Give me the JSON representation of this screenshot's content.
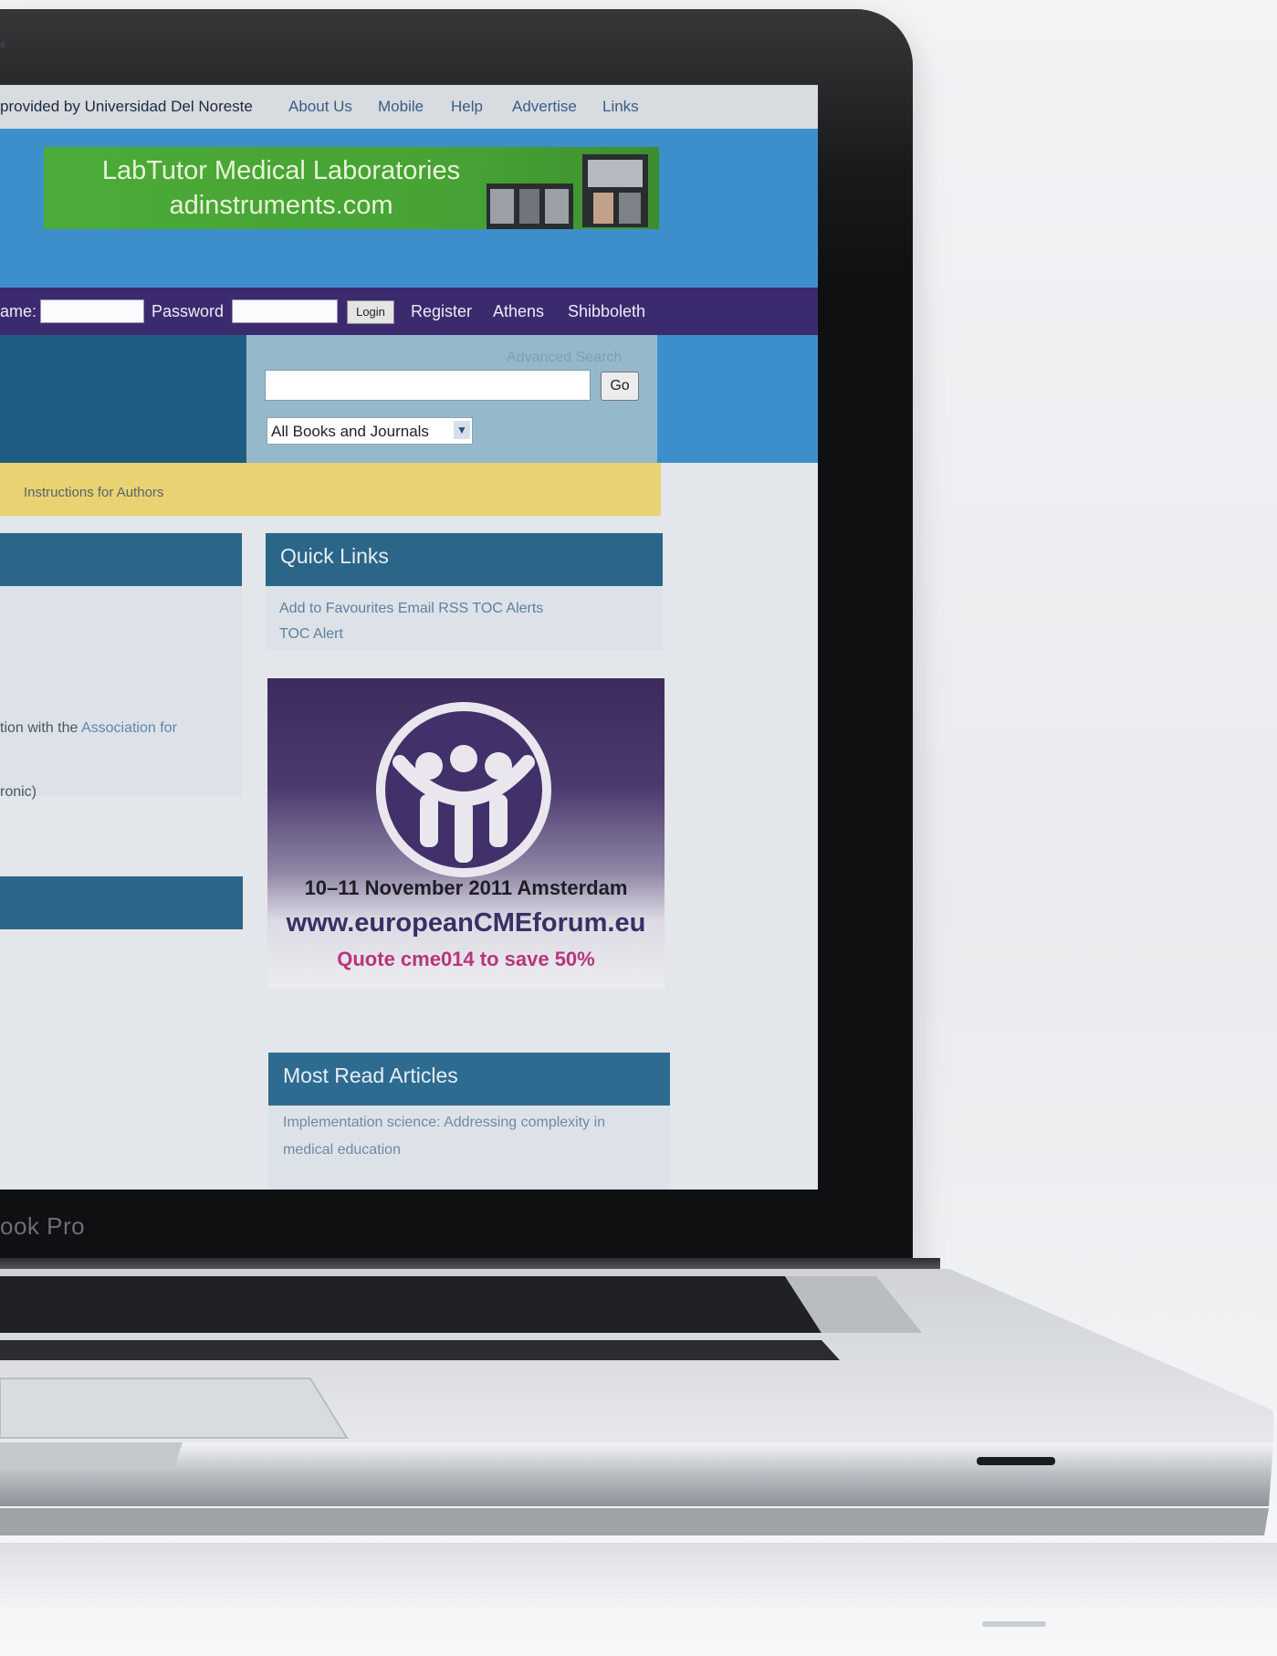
{
  "topbar": {
    "access_notice": "provided by Universidad Del Noreste",
    "links": [
      "About Us",
      "Mobile",
      "Help",
      "Advertise",
      "Links"
    ]
  },
  "banner_ad": {
    "line1": "LabTutor Medical Laboratories",
    "line2": "adinstruments.com"
  },
  "login": {
    "username_label": "ame:",
    "password_label": "Password",
    "login_button": "Login",
    "links": [
      "Register",
      "Athens",
      "Shibboleth"
    ]
  },
  "search": {
    "advanced_link": "Advanced Search",
    "go_button": "Go",
    "scope_selected": "All Books and Journals"
  },
  "nav": {
    "instructions_link": "Instructions for Authors"
  },
  "main": {
    "snippet1_text": "tion with the ",
    "snippet1_link": "Association for",
    "snippet2_text": "ronic)"
  },
  "quick_links": {
    "title": "Quick Links",
    "line1": "Add to Favourites Email   RSS TOC Alerts",
    "line2": "TOC Alert"
  },
  "cme_ad": {
    "date_location": "10–11 November 2011 Amsterdam",
    "url": "www.europeanCMEforum.eu",
    "promo": "Quote cme014 to save 50%"
  },
  "most_read": {
    "title": "Most Read Articles",
    "line1": "Implementation science: Addressing complexity in",
    "line2": "medical education"
  },
  "laptop": {
    "model_label": "ook Pro"
  },
  "colors": {
    "topbar_bg": "#d8dbe0",
    "brand_blue": "#3c8fca",
    "login_purple": "#3c2a6e",
    "nav_yellow": "#e9d272",
    "header_teal": "#2b6688",
    "ad_green": "#4cab38",
    "cme_purple": "#3d2b5f",
    "promo_magenta": "#b8357d"
  }
}
